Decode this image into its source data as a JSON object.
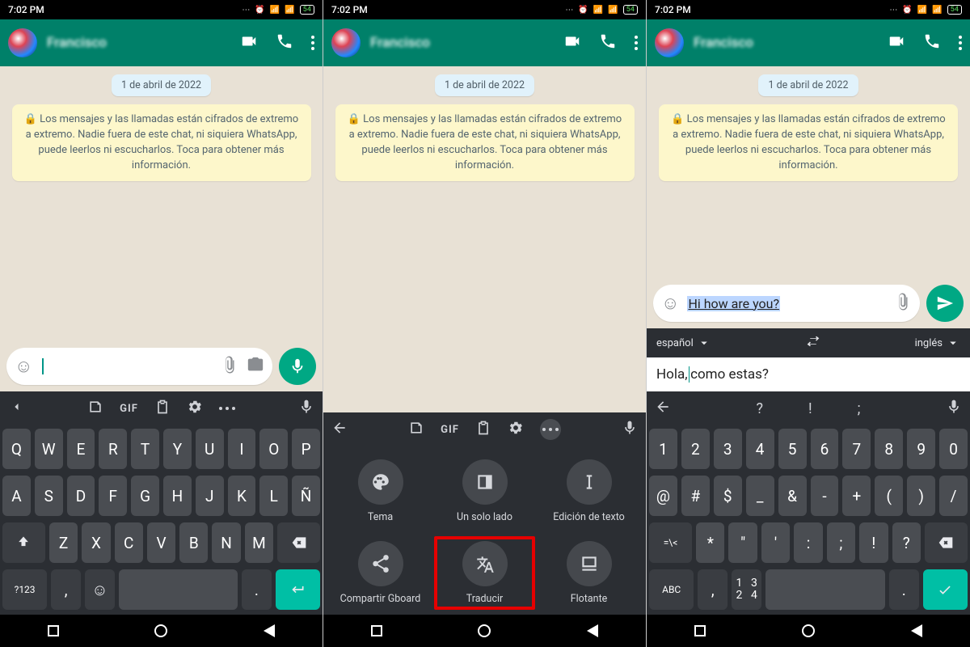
{
  "statusbar": {
    "time": "7:02 PM",
    "battery_text": "54"
  },
  "appbar": {
    "contact_name": "Francisco"
  },
  "chat": {
    "date_label": "1 de abril de 2022",
    "encryption_notice": "🔒 Los mensajes y las llamadas están cifrados de extremo a extremo. Nadie fuera de este chat, ni siquiera WhatsApp, puede leerlos ni escucharlos. Toca para obtener más información."
  },
  "panel3": {
    "input_text": "Hi how are you?",
    "translate_source_lang": "español",
    "translate_target_lang": "inglés",
    "translate_input_before": "Hola,",
    "translate_input_after": " como estas?"
  },
  "keyboard": {
    "gif_label": "GIF",
    "row1": [
      "Q",
      "W",
      "E",
      "R",
      "T",
      "Y",
      "U",
      "I",
      "O",
      "P"
    ],
    "row2": [
      "A",
      "S",
      "D",
      "F",
      "G",
      "H",
      "J",
      "K",
      "L",
      "Ñ"
    ],
    "row3_letters": [
      "Z",
      "X",
      "C",
      "V",
      "B",
      "N",
      "M"
    ],
    "numpad_row": [
      "1",
      "2",
      "3",
      "4",
      "5",
      "6",
      "7",
      "8",
      "9",
      "0"
    ],
    "sym_row1": [
      "@",
      "#",
      "$",
      "_",
      "&",
      "-",
      "+",
      "(",
      ")",
      "/"
    ],
    "sym_row2": [
      "*",
      "\"",
      "'",
      ":",
      ";",
      "!",
      "?"
    ],
    "left_sym_toggle": "=\\<",
    "mode_key_letters": "?123",
    "mode_key_symbols": "ABC",
    "mode_key_symbols2_top": "1 2",
    "mode_key_symbols2_bot": "3 4",
    "comma": ",",
    "period": ".",
    "question": "?",
    "exclaim": "!"
  },
  "kb_menu": {
    "items": [
      {
        "label": "Tema",
        "icon": "palette-icon"
      },
      {
        "label": "Un solo lado",
        "icon": "dock-icon"
      },
      {
        "label": "Edición de texto",
        "icon": "textedit-icon"
      },
      {
        "label": "Compartir Gboard",
        "icon": "share-icon"
      },
      {
        "label": "Traducir",
        "icon": "translate-icon"
      },
      {
        "label": "Flotante",
        "icon": "float-icon"
      }
    ]
  }
}
